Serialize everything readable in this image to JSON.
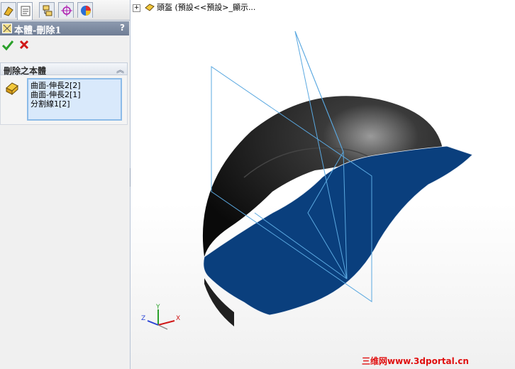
{
  "property_manager": {
    "tabs": [
      {
        "icon": "feature-manager-icon"
      },
      {
        "icon": "property-manager-icon"
      },
      {
        "icon": "configuration-manager-icon"
      },
      {
        "icon": "dim-xpert-icon"
      },
      {
        "icon": "display-manager-icon"
      }
    ],
    "title": "本體-刪除1",
    "help_label": "?",
    "ok_icon": "check-icon",
    "cancel_icon": "cancel-icon",
    "group": {
      "title": "刪除之本體",
      "collapse_label": "︽",
      "bodies": [
        "曲面-伸長2[2]",
        "曲面-伸長2[1]",
        "分割線1[2]"
      ]
    }
  },
  "tree": {
    "expand_label": "+",
    "item_text": "頭盔 (預設<<預設>_顯示..."
  },
  "triad": {
    "x": "X",
    "y": "Y",
    "z": "Z"
  },
  "watermark": "三维网www.3dportal.cn",
  "colors": {
    "shell_dark": "#1a1a1a",
    "surface_blue": "#0a3f7d",
    "plane_outline": "#5aa8e0",
    "ok_green": "#2aa02a",
    "cancel_red": "#d01818"
  }
}
